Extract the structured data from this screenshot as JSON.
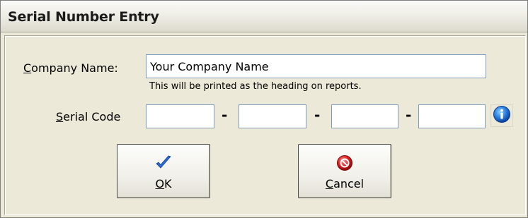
{
  "window": {
    "title": "Serial Number Entry"
  },
  "company": {
    "label_prefix": "",
    "label_accel": "C",
    "label_rest": "ompany Name:",
    "value": "Your Company Name",
    "hint": "This will be printed as the heading on reports."
  },
  "serial": {
    "label_accel": "S",
    "label_rest": "erial Code",
    "separator": "-",
    "segments": [
      "",
      "",
      "",
      ""
    ]
  },
  "info_button": {
    "icon": "info-icon",
    "color": "#1565c0"
  },
  "buttons": {
    "ok": {
      "label_accel": "O",
      "label_rest": "K",
      "icon": "checkmark-icon",
      "icon_color": "#2b6bd6"
    },
    "cancel": {
      "label_accel": "C",
      "label_rest": "ancel",
      "icon": "stop-icon",
      "icon_color": "#d32020"
    }
  }
}
